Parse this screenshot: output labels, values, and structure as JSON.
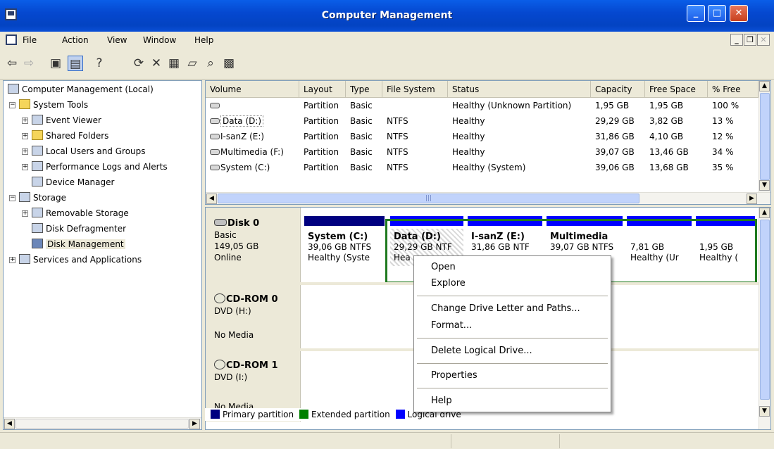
{
  "window": {
    "title": "Computer Management"
  },
  "menu": {
    "items": [
      "File",
      "Action",
      "View",
      "Window",
      "Help"
    ]
  },
  "tree": {
    "root": "Computer Management (Local)",
    "system_tools": "System Tools",
    "event_viewer": "Event Viewer",
    "shared_folders": "Shared Folders",
    "local_users": "Local Users and Groups",
    "perf_logs": "Performance Logs and Alerts",
    "device_manager": "Device Manager",
    "storage": "Storage",
    "removable": "Removable Storage",
    "defrag": "Disk Defragmenter",
    "disk_mgmt": "Disk Management",
    "services": "Services and Applications"
  },
  "volumes": {
    "columns": [
      "Volume",
      "Layout",
      "Type",
      "File System",
      "Status",
      "Capacity",
      "Free Space",
      "% Free"
    ],
    "rows": [
      [
        "",
        "Partition",
        "Basic",
        "",
        "Healthy (Unknown Partition)",
        "1,95 GB",
        "1,95 GB",
        "100 %"
      ],
      [
        "Data (D:)",
        "Partition",
        "Basic",
        "NTFS",
        "Healthy",
        "29,29 GB",
        "3,82 GB",
        "13 %"
      ],
      [
        "I-sanZ (E:)",
        "Partition",
        "Basic",
        "NTFS",
        "Healthy",
        "31,86 GB",
        "4,10 GB",
        "12 %"
      ],
      [
        "Multimedia (F:)",
        "Partition",
        "Basic",
        "NTFS",
        "Healthy",
        "39,07 GB",
        "13,46 GB",
        "34 %"
      ],
      [
        "System (C:)",
        "Partition",
        "Basic",
        "NTFS",
        "Healthy (System)",
        "39,06 GB",
        "13,68 GB",
        "35 %"
      ]
    ],
    "scroll_glyph": "|||"
  },
  "disks": {
    "disk0": {
      "name": "Disk 0",
      "type": "Basic",
      "size": "149,05 GB",
      "state": "Online"
    },
    "cd0": {
      "name": "CD-ROM 0",
      "type": "DVD (H:)",
      "state": "No Media"
    },
    "cd1": {
      "name": "CD-ROM 1",
      "type": "DVD (I:)",
      "state": "No Media"
    },
    "partitions": [
      {
        "name": "System  (C:)",
        "size": "39,06 GB NTFS",
        "status": "Healthy (Syste"
      },
      {
        "name": "Data  (D:)",
        "size": "29,29 GB NTF",
        "status": "Hea"
      },
      {
        "name": "I-sanZ  (E:)",
        "size": "31,86 GB NTF",
        "status": ""
      },
      {
        "name": "Multimedia",
        "size": "39,07 GB NTFS",
        "status": ""
      },
      {
        "name": "",
        "size": "7,81 GB",
        "status": "Healthy (Ur"
      },
      {
        "name": "",
        "size": "1,95 GB",
        "status": "Healthy ("
      }
    ]
  },
  "legend": [
    "Primary partition",
    "Extended partition",
    "Logical drive"
  ],
  "colors": {
    "primary": "#000080",
    "extended": "#008000",
    "logical": "#0000ff",
    "title_bar": "#0548d0"
  },
  "context_menu": [
    "Open",
    "Explore",
    "Change Drive Letter and Paths...",
    "Format...",
    "Delete Logical Drive...",
    "Properties",
    "Help"
  ]
}
